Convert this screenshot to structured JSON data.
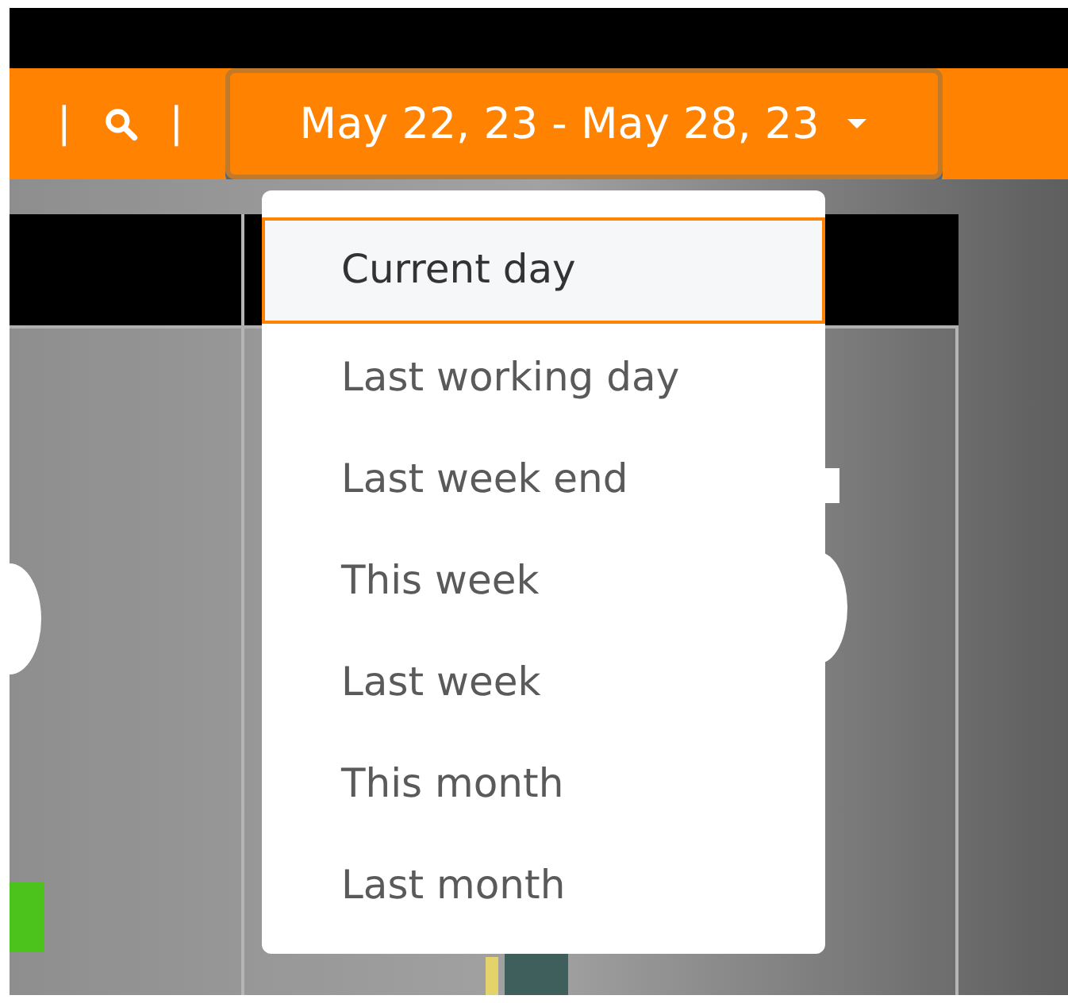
{
  "toolbar": {
    "separators": [
      "|",
      "|"
    ],
    "date_range": "May 22, 23 - May 28, 23"
  },
  "menu": {
    "items": [
      {
        "label": "Current day",
        "selected": true
      },
      {
        "label": "Last working day",
        "selected": false
      },
      {
        "label": "Last week end",
        "selected": false
      },
      {
        "label": "This week",
        "selected": false
      },
      {
        "label": "Last week",
        "selected": false
      },
      {
        "label": "This month",
        "selected": false
      },
      {
        "label": "Last month",
        "selected": false
      }
    ]
  }
}
